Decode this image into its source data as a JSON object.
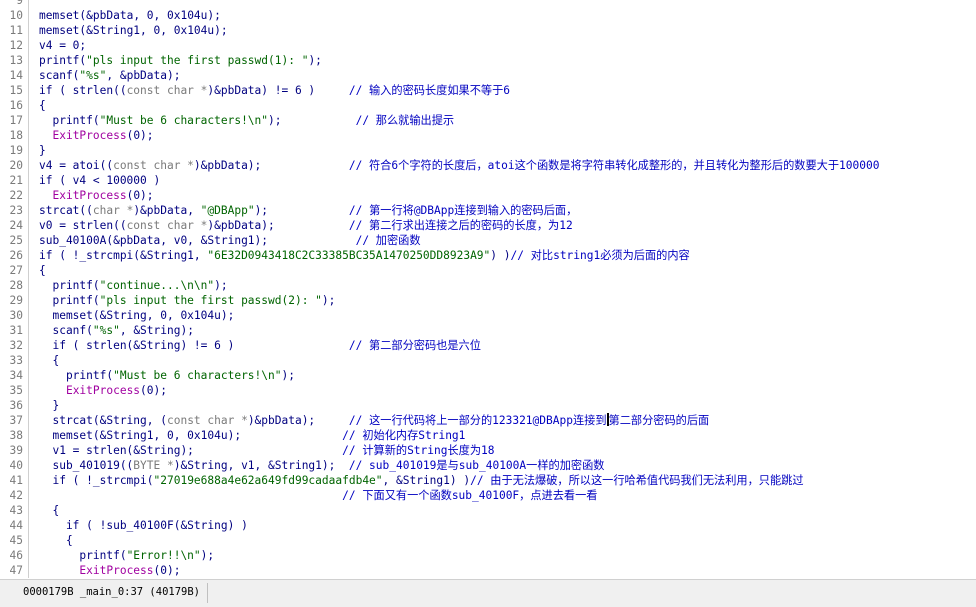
{
  "editor": {
    "lines": [
      {
        "num": "9",
        "tokens": []
      },
      {
        "num": "10",
        "tokens": [
          {
            "t": "memset(&",
            "c": "plain"
          },
          {
            "t": "pbData",
            "c": "plain"
          },
          {
            "t": ", 0, 0x104u);",
            "c": "plain"
          }
        ]
      },
      {
        "num": "11",
        "tokens": [
          {
            "t": "memset(&",
            "c": "plain"
          },
          {
            "t": "String1",
            "c": "plain"
          },
          {
            "t": ", 0, 0x104u);",
            "c": "plain"
          }
        ]
      },
      {
        "num": "12",
        "tokens": [
          {
            "t": "v4 = 0;",
            "c": "plain"
          }
        ]
      },
      {
        "num": "13",
        "tokens": [
          {
            "t": "printf(",
            "c": "plain"
          },
          {
            "t": "\"pls input the first passwd(1): \"",
            "c": "str"
          },
          {
            "t": ");",
            "c": "plain"
          }
        ]
      },
      {
        "num": "14",
        "tokens": [
          {
            "t": "scanf(",
            "c": "plain"
          },
          {
            "t": "\"%s\"",
            "c": "str"
          },
          {
            "t": ", &pbData);",
            "c": "plain"
          }
        ]
      },
      {
        "num": "15",
        "tokens": [
          {
            "t": "if ( strlen((",
            "c": "plain"
          },
          {
            "t": "const char *",
            "c": "gray"
          },
          {
            "t": ")&pbData) != 6 )     ",
            "c": "plain"
          },
          {
            "t": "// 输入的密码长度如果不等于6",
            "c": "cmt"
          }
        ]
      },
      {
        "num": "16",
        "tokens": [
          {
            "t": "{",
            "c": "plain"
          }
        ]
      },
      {
        "num": "17",
        "tokens": [
          {
            "t": "  printf(",
            "c": "plain"
          },
          {
            "t": "\"Must be 6 characters!\\n\"",
            "c": "str"
          },
          {
            "t": ");           ",
            "c": "plain"
          },
          {
            "t": "// 那么就输出提示",
            "c": "cmt"
          }
        ]
      },
      {
        "num": "18",
        "tokens": [
          {
            "t": "  ",
            "c": "plain"
          },
          {
            "t": "ExitProcess",
            "c": "fn"
          },
          {
            "t": "(0);",
            "c": "plain"
          }
        ]
      },
      {
        "num": "19",
        "tokens": [
          {
            "t": "}",
            "c": "plain"
          }
        ]
      },
      {
        "num": "20",
        "tokens": [
          {
            "t": "v4 = atoi((",
            "c": "plain"
          },
          {
            "t": "const char *",
            "c": "gray"
          },
          {
            "t": ")&pbData);             ",
            "c": "plain"
          },
          {
            "t": "// 符合6个字符的长度后，atoi这个函数是将字符串转化成整形的，并且转化为整形后的数要大于100000",
            "c": "cmt"
          }
        ]
      },
      {
        "num": "21",
        "tokens": [
          {
            "t": "if ( v4 < 100000 )",
            "c": "plain"
          }
        ]
      },
      {
        "num": "22",
        "tokens": [
          {
            "t": "  ",
            "c": "plain"
          },
          {
            "t": "ExitProcess",
            "c": "fn"
          },
          {
            "t": "(0);",
            "c": "plain"
          }
        ]
      },
      {
        "num": "23",
        "tokens": [
          {
            "t": "strcat((",
            "c": "plain"
          },
          {
            "t": "char *",
            "c": "gray"
          },
          {
            "t": ")&pbData, ",
            "c": "plain"
          },
          {
            "t": "\"@DBApp\"",
            "c": "str"
          },
          {
            "t": ");            ",
            "c": "plain"
          },
          {
            "t": "// 第一行将@DBApp连接到输入的密码后面，",
            "c": "cmt"
          }
        ]
      },
      {
        "num": "24",
        "tokens": [
          {
            "t": "v0 = strlen((",
            "c": "plain"
          },
          {
            "t": "const char *",
            "c": "gray"
          },
          {
            "t": ")&pbData);           ",
            "c": "plain"
          },
          {
            "t": "// 第二行求出连接之后的密码的长度，为12",
            "c": "cmt"
          }
        ]
      },
      {
        "num": "25",
        "tokens": [
          {
            "t": "sub_40100A(&pbData, v0, &String1);             ",
            "c": "plain"
          },
          {
            "t": "// 加密函数",
            "c": "cmt"
          }
        ]
      },
      {
        "num": "26",
        "tokens": [
          {
            "t": "if ( !_strcmpi(&String1, ",
            "c": "plain"
          },
          {
            "t": "\"6E32D0943418C2C33385BC35A1470250DD8923A9\"",
            "c": "str"
          },
          {
            "t": ") )",
            "c": "plain"
          },
          {
            "t": "// 对比string1必须为后面的内容",
            "c": "cmt"
          }
        ]
      },
      {
        "num": "27",
        "tokens": [
          {
            "t": "{",
            "c": "plain"
          }
        ]
      },
      {
        "num": "28",
        "tokens": [
          {
            "t": "  printf(",
            "c": "plain"
          },
          {
            "t": "\"continue...\\n\\n\"",
            "c": "str"
          },
          {
            "t": ");",
            "c": "plain"
          }
        ]
      },
      {
        "num": "29",
        "tokens": [
          {
            "t": "  printf(",
            "c": "plain"
          },
          {
            "t": "\"pls input the first passwd(2): \"",
            "c": "str"
          },
          {
            "t": ");",
            "c": "plain"
          }
        ]
      },
      {
        "num": "30",
        "tokens": [
          {
            "t": "  memset(&String, 0, 0x104u);",
            "c": "plain"
          }
        ]
      },
      {
        "num": "31",
        "tokens": [
          {
            "t": "  scanf(",
            "c": "plain"
          },
          {
            "t": "\"%s\"",
            "c": "str"
          },
          {
            "t": ", &String);",
            "c": "plain"
          }
        ]
      },
      {
        "num": "32",
        "tokens": [
          {
            "t": "  if ( strlen(&String) != 6 )                 ",
            "c": "plain"
          },
          {
            "t": "// 第二部分密码也是六位",
            "c": "cmt"
          }
        ]
      },
      {
        "num": "33",
        "tokens": [
          {
            "t": "  {",
            "c": "plain"
          }
        ]
      },
      {
        "num": "34",
        "tokens": [
          {
            "t": "    printf(",
            "c": "plain"
          },
          {
            "t": "\"Must be 6 characters!\\n\"",
            "c": "str"
          },
          {
            "t": ");",
            "c": "plain"
          }
        ]
      },
      {
        "num": "35",
        "tokens": [
          {
            "t": "    ",
            "c": "plain"
          },
          {
            "t": "ExitProcess",
            "c": "fn"
          },
          {
            "t": "(0);",
            "c": "plain"
          }
        ]
      },
      {
        "num": "36",
        "tokens": [
          {
            "t": "  }",
            "c": "plain"
          }
        ]
      },
      {
        "num": "37",
        "tokens": [
          {
            "t": "  strcat(&String, (",
            "c": "plain"
          },
          {
            "t": "const char *",
            "c": "gray"
          },
          {
            "t": ")&pbData);     ",
            "c": "plain"
          },
          {
            "t": "// 这一行代码将上一部分的123321@DBApp连接到",
            "c": "cmt"
          },
          {
            "t": "",
            "c": "caret"
          },
          {
            "t": "第二部分密码的后面",
            "c": "cmt"
          }
        ]
      },
      {
        "num": "38",
        "tokens": [
          {
            "t": "  memset(&String1, 0, 0x104u);               ",
            "c": "plain"
          },
          {
            "t": "// 初始化内存String1",
            "c": "cmt"
          }
        ]
      },
      {
        "num": "39",
        "tokens": [
          {
            "t": "  v1 = strlen(&String);                      ",
            "c": "plain"
          },
          {
            "t": "// 计算新的String长度为18",
            "c": "cmt"
          }
        ]
      },
      {
        "num": "40",
        "tokens": [
          {
            "t": "  sub_401019((",
            "c": "plain"
          },
          {
            "t": "BYTE *",
            "c": "gray"
          },
          {
            "t": ")&String, v1, &String1);  ",
            "c": "plain"
          },
          {
            "t": "// sub_401019是与sub_40100A一样的加密函数",
            "c": "cmt"
          }
        ]
      },
      {
        "num": "41",
        "tokens": [
          {
            "t": "  if ( !_strcmpi(",
            "c": "plain"
          },
          {
            "t": "\"27019e688a4e62a649fd99cadaafdb4e\"",
            "c": "str"
          },
          {
            "t": ", &String1) )",
            "c": "plain"
          },
          {
            "t": "// 由于无法爆破，所以这一行哈希值代码我们无法利用，只能跳过",
            "c": "cmt"
          }
        ]
      },
      {
        "num": "42",
        "tokens": [
          {
            "t": "                                             ",
            "c": "plain"
          },
          {
            "t": "// 下面又有一个函数sub_40100F，点进去看一看",
            "c": "cmt"
          }
        ]
      },
      {
        "num": "43",
        "tokens": [
          {
            "t": "  {",
            "c": "plain"
          }
        ]
      },
      {
        "num": "44",
        "tokens": [
          {
            "t": "    if ( !sub_40100F(&String) )",
            "c": "plain"
          }
        ]
      },
      {
        "num": "45",
        "tokens": [
          {
            "t": "    {",
            "c": "plain"
          }
        ]
      },
      {
        "num": "46",
        "tokens": [
          {
            "t": "      printf(",
            "c": "plain"
          },
          {
            "t": "\"Error!!\\n\"",
            "c": "str"
          },
          {
            "t": ");",
            "c": "plain"
          }
        ]
      },
      {
        "num": "47",
        "tokens": [
          {
            "t": "      ",
            "c": "plain"
          },
          {
            "t": "ExitProcess",
            "c": "fn"
          },
          {
            "t": "(0);",
            "c": "plain"
          }
        ]
      }
    ]
  },
  "statusbar": {
    "location": "0000179B _main_0:37 (40179B)"
  }
}
